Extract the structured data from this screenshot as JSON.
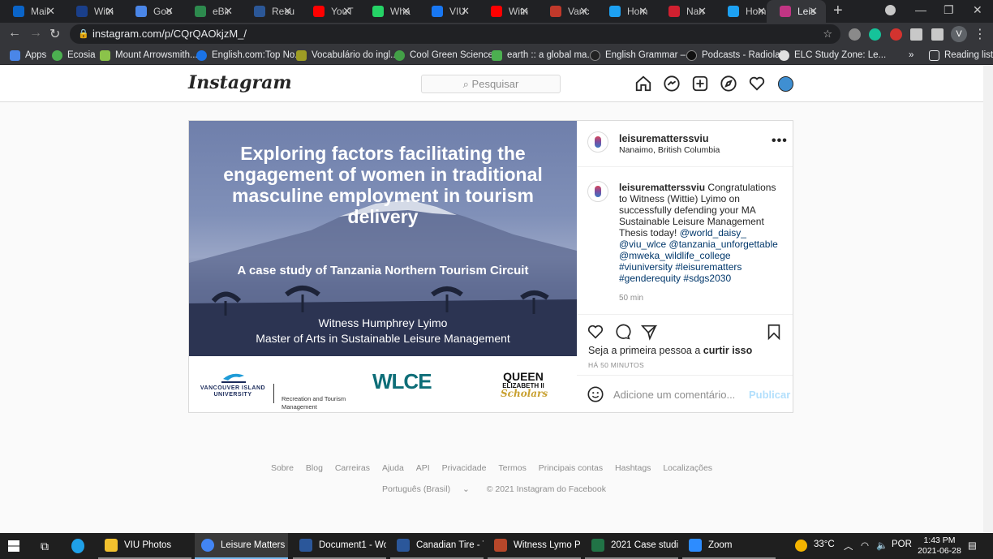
{
  "browser": {
    "tabs": [
      {
        "label": "Mail",
        "color": "#0a64c8"
      },
      {
        "label": "Witn",
        "color": "#1a3f8a"
      },
      {
        "label": "Goo",
        "color": "#4a86e8"
      },
      {
        "label": "eBir",
        "color": "#2d8a4e"
      },
      {
        "label": "Resu",
        "color": "#2b5797"
      },
      {
        "label": "YouT",
        "color": "#ff0000"
      },
      {
        "label": "Wha",
        "color": "#25d366"
      },
      {
        "label": "VIU",
        "color": "#1877f2"
      },
      {
        "label": "Witn",
        "color": "#ff0000"
      },
      {
        "label": "Vanc",
        "color": "#c0392b"
      },
      {
        "label": "Hom",
        "color": "#1da1f2"
      },
      {
        "label": "Nan",
        "color": "#d02030"
      },
      {
        "label": "Hom",
        "color": "#1da1f2"
      },
      {
        "label": "Leis",
        "color": "#c13584"
      }
    ],
    "url": "instagram.com/p/CQrQAOkjzM_/",
    "profile_initial": "V",
    "bookmarks": [
      {
        "label": "Apps",
        "color": "#4a86e8"
      },
      {
        "label": "Ecosia",
        "color": "#4caf50"
      },
      {
        "label": "Mount Arrowsmith...",
        "color": "#8bc34a"
      },
      {
        "label": "English.com:Top No...",
        "color": "#1a73e8"
      },
      {
        "label": "Vocabulário do ingl...",
        "color": "#9e9d24"
      },
      {
        "label": "Cool Green Science...",
        "color": "#43a047"
      },
      {
        "label": "earth :: a global ma...",
        "color": "#4caf50"
      },
      {
        "label": "English Grammar –...",
        "color": "#222222"
      },
      {
        "label": "Podcasts - Radiolab",
        "color": "#111111"
      },
      {
        "label": "ELC Study Zone: Le...",
        "color": "#e0e0e0"
      }
    ],
    "reading_list": "Reading list"
  },
  "instagram": {
    "logo": "Instagram",
    "search_placeholder": "Pesquisar",
    "post": {
      "image_title": "Exploring factors facilitating the engagement of women in traditional masculine employment in tourism delivery",
      "image_subtitle": "A case study of Tanzania Northern Tourism Circuit",
      "image_author": "Witness Humphrey Lyimo",
      "image_degree": "Master of Arts in Sustainable Leisure Management",
      "logo_viu": "VANCOUVER ISLAND UNIVERSITY",
      "logo_viu_dept": "Recreation and Tourism Management",
      "logo_wlce": "WLCE",
      "logo_qe_line1": "QUEEN",
      "logo_qe_line2": "ELIZABETH II",
      "logo_qe_line3": "Scholars",
      "username": "leisurematterssviu",
      "location": "Nanaimo, British Columbia",
      "more": "•••",
      "caption_user": "leisurematterssviu",
      "caption_text": "Congratulations to Witness (Wittie) Lyimo on successfully defending your MA Sustainable Leisure Management Thesis today!",
      "caption_tags": "@world_daisy_ @viu_wlce @tanzania_unforgettable @mweka_wildlife_college #viuniversity #leisurematters #genderequity #sdgs2030",
      "caption_time": "50 min",
      "likes_prefix": "Seja a primeira pessoa a",
      "likes_link": "curtir isso",
      "time_ago": "HÁ 50 MINUTOS",
      "comment_placeholder": "Adicione um comentário...",
      "publish": "Publicar"
    },
    "footer_links": [
      "Sobre",
      "Blog",
      "Carreiras",
      "Ajuda",
      "API",
      "Privacidade",
      "Termos",
      "Principais contas",
      "Hashtags",
      "Localizações"
    ],
    "language": "Português (Brasil)",
    "copyright": "© 2021 Instagram do Facebook"
  },
  "taskbar": {
    "items": [
      {
        "label": "VIU Photos",
        "color": "#f2c12e"
      },
      {
        "label": "Leisure Matters n...",
        "color": "#4285f4"
      },
      {
        "label": "Document1 - Word",
        "color": "#2b579a"
      },
      {
        "label": "Canadian Tire - T...",
        "color": "#2b579a"
      },
      {
        "label": "Witness Lymo Po...",
        "color": "#b7472a"
      },
      {
        "label": "2021 Case studies...",
        "color": "#217346"
      },
      {
        "label": "Zoom",
        "color": "#2d8cff"
      }
    ],
    "weather": "33°C",
    "lang": "POR",
    "time": "1:43 PM",
    "date": "2021-06-28"
  }
}
